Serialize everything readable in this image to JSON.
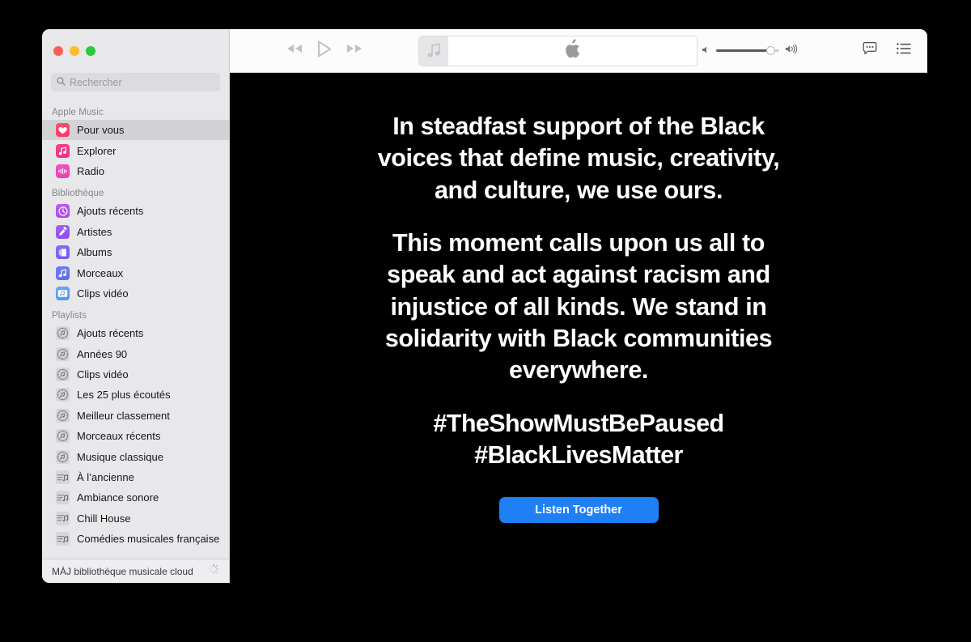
{
  "window": {
    "traffic_lights": [
      "close-button",
      "minimize-button",
      "maximize-button"
    ]
  },
  "search": {
    "placeholder": "Rechercher",
    "value": "",
    "icon": "search-icon"
  },
  "sidebar": {
    "sections": [
      {
        "title": "Apple Music",
        "items": [
          {
            "label": "Pour vous",
            "icon": "heart-icon",
            "icon_class": "heart",
            "selected": true
          },
          {
            "label": "Explorer",
            "icon": "music-note-icon",
            "icon_class": "note",
            "selected": false
          },
          {
            "label": "Radio",
            "icon": "radio-waves-icon",
            "icon_class": "radio",
            "selected": false
          }
        ]
      },
      {
        "title": "Bibliothèque",
        "items": [
          {
            "label": "Ajouts récents",
            "icon": "clock-icon",
            "icon_class": "clock",
            "selected": false
          },
          {
            "label": "Artistes",
            "icon": "microphone-icon",
            "icon_class": "mic",
            "selected": false
          },
          {
            "label": "Albums",
            "icon": "albums-icon",
            "icon_class": "albums",
            "selected": false
          },
          {
            "label": "Morceaux",
            "icon": "music-note-icon",
            "icon_class": "songs",
            "selected": false
          },
          {
            "label": "Clips vidéo",
            "icon": "video-clip-icon",
            "icon_class": "video",
            "selected": false
          }
        ]
      },
      {
        "title": "Playlists",
        "items": [
          {
            "label": "Ajouts récents",
            "icon": "smart-playlist-icon",
            "icon_class": "smart",
            "selected": false
          },
          {
            "label": "Années 90",
            "icon": "smart-playlist-icon",
            "icon_class": "smart",
            "selected": false
          },
          {
            "label": "Clips vidéo",
            "icon": "smart-playlist-icon",
            "icon_class": "smart",
            "selected": false
          },
          {
            "label": "Les 25 plus écoutés",
            "icon": "smart-playlist-icon",
            "icon_class": "smart",
            "selected": false
          },
          {
            "label": "Meilleur classement",
            "icon": "smart-playlist-icon",
            "icon_class": "smart",
            "selected": false
          },
          {
            "label": "Morceaux récents",
            "icon": "smart-playlist-icon",
            "icon_class": "smart",
            "selected": false
          },
          {
            "label": "Musique classique",
            "icon": "smart-playlist-icon",
            "icon_class": "smart",
            "selected": false
          },
          {
            "label": "À l’ancienne",
            "icon": "playlist-icon",
            "icon_class": "plist",
            "selected": false
          },
          {
            "label": "Ambiance sonore",
            "icon": "playlist-icon",
            "icon_class": "plist",
            "selected": false
          },
          {
            "label": "Chill House",
            "icon": "playlist-icon",
            "icon_class": "plist",
            "selected": false
          },
          {
            "label": "Comédies musicales française",
            "icon": "playlist-icon",
            "icon_class": "plist",
            "selected": false
          }
        ]
      }
    ],
    "status": {
      "text": "MÀJ bibliothèque musicale cloud",
      "spinner": "loading-spinner-icon"
    }
  },
  "toolbar": {
    "rewind": "rewind-icon",
    "play": "play-icon",
    "forward": "fast-forward-icon",
    "lcd": {
      "artwork_icon": "music-note-icon",
      "center_icon": "apple-logo-icon"
    },
    "volume": {
      "low_icon": "volume-low-icon",
      "high_icon": "volume-high-icon",
      "level": 86
    },
    "lyrics_icon": "lyrics-bubble-icon",
    "queue_icon": "queue-list-icon"
  },
  "content": {
    "paragraph1": "In steadfast support of the Black voices that define music, creativity, and culture, we use ours.",
    "paragraph2": "This moment calls upon us all to speak and act against racism and injustice of all kinds. We stand in solidarity with Black communities everywhere.",
    "hashtag1": "#TheShowMustBePaused",
    "hashtag2": "#BlackLivesMatter",
    "button_label": "Listen Together",
    "accent_color": "#1f7ff5",
    "background_color": "#000000"
  }
}
